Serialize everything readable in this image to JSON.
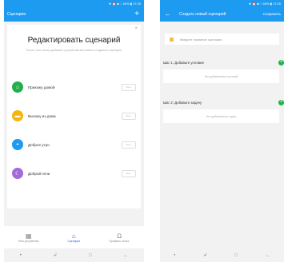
{
  "left": {
    "status": "★ ⏰ ■ ∷ 65% ▮ 17:20",
    "title": "Сценарии",
    "plus": "+",
    "close": "×",
    "heading": "Редактировать сценарий",
    "description": "После того как вы добавите устройства вы можете создавать сценарии",
    "scenes": [
      {
        "label": "Прихожу домой",
        "icon": "home-icon",
        "color": "#22b04b",
        "btn": "Вып."
      },
      {
        "label": "Выхожу из дома",
        "icon": "briefcase-icon",
        "color": "#f5b50b",
        "btn": "Вып."
      },
      {
        "label": "Доброе утро",
        "icon": "sunrise-icon",
        "color": "#1d9bf0",
        "btn": "Вып."
      },
      {
        "label": "Доброй ночи",
        "icon": "moon-icon",
        "color": "#a66ad8",
        "btn": "Вып."
      }
    ],
    "tabs": [
      {
        "label": "Мои устройства",
        "glyph": "▦"
      },
      {
        "label": "Сценарии",
        "glyph": "⌂"
      },
      {
        "label": "Профиль польз.",
        "glyph": "Ω"
      }
    ]
  },
  "right": {
    "status": "★ ⏰ ■ ∷ 65% ▮ 17:20",
    "back": "←",
    "title": "Создать новый сценарий",
    "save": "Сохранить",
    "name_placeholder": "Введите название сценария",
    "step1": "Шаг 1: Добавьте условие",
    "step1_empty": "Нет добавленных условий",
    "step2": "Шаг 2: Добавьте задачу",
    "step2_empty": "Нет добавленных задач",
    "add": "+"
  },
  "navbar": [
    "•",
    "↲",
    "□",
    "←"
  ]
}
